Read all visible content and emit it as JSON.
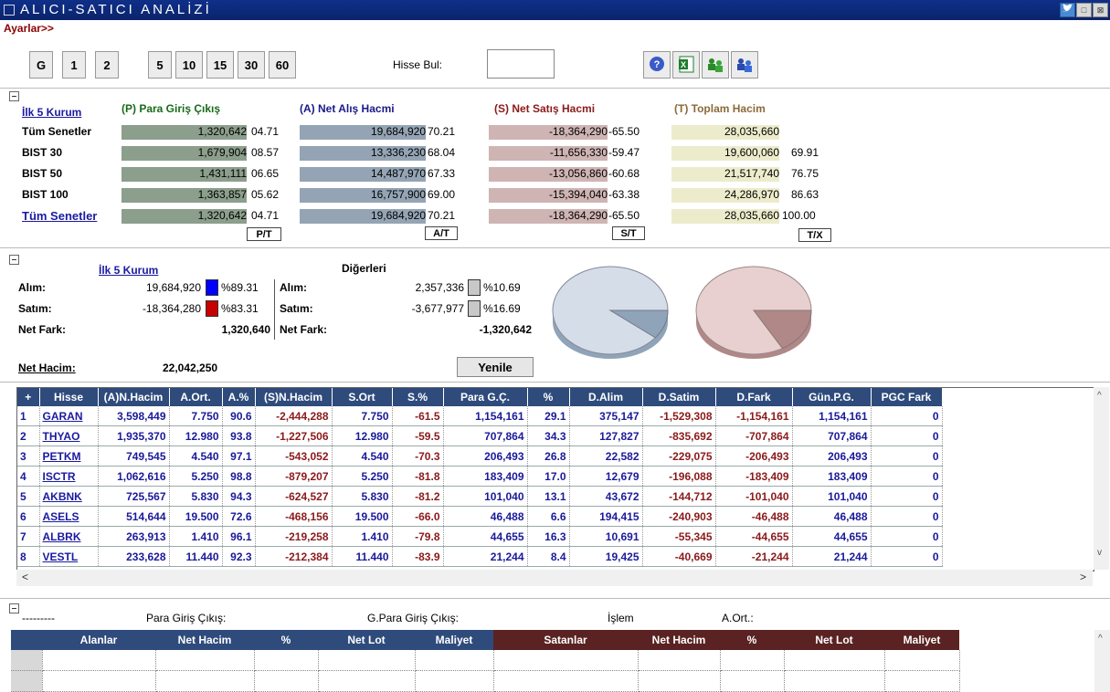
{
  "window": {
    "title": "ALICI-SATICI ANALİZİ",
    "min": "□",
    "close": "⊠"
  },
  "menu": {
    "ayarlar": "Ayarlar>>"
  },
  "toolbar": {
    "periods": [
      "G",
      "1",
      "2"
    ],
    "periods2": [
      "5",
      "10",
      "15",
      "30",
      "60"
    ],
    "search_label": "Hisse Bul:",
    "search_value": ""
  },
  "summary": {
    "col_label": "İlk 5 Kurum",
    "headers": {
      "p": "(P) Para Giriş Çıkış",
      "a": "(A) Net Alış Hacmi",
      "s": "(S) Net Satış Hacmi",
      "t": "(T) Toplam Hacim"
    },
    "rows": [
      {
        "name": "Tüm Senetler",
        "p": "1,320,642",
        "pp": "04.71",
        "a": "19,684,920",
        "ap": "70.21",
        "s": "-18,364,290",
        "sp": "-65.50",
        "t": "28,035,660",
        "tp": ""
      },
      {
        "name": "BIST 30",
        "p": "1,679,904",
        "pp": "08.57",
        "a": "13,336,230",
        "ap": "68.04",
        "s": "-11,656,330",
        "sp": "-59.47",
        "t": "19,600,060",
        "tp": "69.91"
      },
      {
        "name": "BIST 50",
        "p": "1,431,111",
        "pp": "06.65",
        "a": "14,487,970",
        "ap": "67.33",
        "s": "-13,056,860",
        "sp": "-60.68",
        "t": "21,517,740",
        "tp": "76.75"
      },
      {
        "name": "BIST 100",
        "p": "1,363,857",
        "pp": "05.62",
        "a": "16,757,900",
        "ap": "69.00",
        "s": "-15,394,040",
        "sp": "-63.38",
        "t": "24,286,970",
        "tp": "86.63"
      },
      {
        "name": "Tüm Senetler",
        "p": "1,320,642",
        "pp": "04.71",
        "a": "19,684,920",
        "ap": "70.21",
        "s": "-18,364,290",
        "sp": "-65.50",
        "t": "28,035,660",
        "tp": "100.00"
      }
    ],
    "sort_buttons": [
      "P/T",
      "A/T",
      "S/T",
      "T/X"
    ]
  },
  "compare": {
    "ilk5_label": "İlk 5 Kurum",
    "digerleri_label": "Diğerleri",
    "alim_label": "Alım:",
    "satim_label": "Satım:",
    "netfark_label": "Net Fark:",
    "ilk5": {
      "alim": "19,684,920",
      "alim_pct": "%89.31",
      "satim": "-18,364,280",
      "satim_pct": "%83.31",
      "netfark": "1,320,640"
    },
    "diger": {
      "alim": "2,357,336",
      "alim_pct": "%10.69",
      "satim": "-3,677,977",
      "satim_pct": "%16.69",
      "netfark": "-1,320,642"
    },
    "nethacim_label": "Net Hacim:",
    "nethacim": "22,042,250",
    "yenile": "Yenile"
  },
  "pies": [
    {
      "share": 0.1069
    },
    {
      "share": 0.1669
    }
  ],
  "table": {
    "columns": [
      "+",
      "Hisse",
      "(A)N.Hacim",
      "A.Ort.",
      "A.%",
      "(S)N.Hacim",
      "S.Ort",
      "S.%",
      "Para G.Ç.",
      "%",
      "D.Alim",
      "D.Satim",
      "D.Fark",
      "Gün.P.G.",
      "PGC Fark"
    ],
    "rows": [
      [
        "1",
        "GARAN",
        "3,598,449",
        "7.750",
        "90.6",
        "-2,444,288",
        "7.750",
        "-61.5",
        "1,154,161",
        "29.1",
        "375,147",
        "-1,529,308",
        "-1,154,161",
        "1,154,161",
        "0"
      ],
      [
        "2",
        "THYAO",
        "1,935,370",
        "12.980",
        "93.8",
        "-1,227,506",
        "12.980",
        "-59.5",
        "707,864",
        "34.3",
        "127,827",
        "-835,692",
        "-707,864",
        "707,864",
        "0"
      ],
      [
        "3",
        "PETKM",
        "749,545",
        "4.540",
        "97.1",
        "-543,052",
        "4.540",
        "-70.3",
        "206,493",
        "26.8",
        "22,582",
        "-229,075",
        "-206,493",
        "206,493",
        "0"
      ],
      [
        "4",
        "ISCTR",
        "1,062,616",
        "5.250",
        "98.8",
        "-879,207",
        "5.250",
        "-81.8",
        "183,409",
        "17.0",
        "12,679",
        "-196,088",
        "-183,409",
        "183,409",
        "0"
      ],
      [
        "5",
        "AKBNK",
        "725,567",
        "5.830",
        "94.3",
        "-624,527",
        "5.830",
        "-81.2",
        "101,040",
        "13.1",
        "43,672",
        "-144,712",
        "-101,040",
        "101,040",
        "0"
      ],
      [
        "6",
        "ASELS",
        "514,644",
        "19.500",
        "72.6",
        "-468,156",
        "19.500",
        "-66.0",
        "46,488",
        "6.6",
        "194,415",
        "-240,903",
        "-46,488",
        "46,488",
        "0"
      ],
      [
        "7",
        "ALBRK",
        "263,913",
        "1.410",
        "96.1",
        "-219,258",
        "1.410",
        "-79.8",
        "44,655",
        "16.3",
        "10,691",
        "-55,345",
        "-44,655",
        "44,655",
        "0"
      ],
      [
        "8",
        "VESTL",
        "233,628",
        "11.440",
        "92.3",
        "-212,384",
        "11.440",
        "-83.9",
        "21,244",
        "8.4",
        "19,425",
        "-40,669",
        "-21,244",
        "21,244",
        "0"
      ]
    ]
  },
  "bottom": {
    "dashes": "---------",
    "pgc": "Para Giriş Çıkış:",
    "gpgc": "G.Para Giriş Çıkış:",
    "islem": "İşlem",
    "aort": "A.Ort.:",
    "buyers_cols": [
      "Alanlar",
      "Net Hacim",
      "%",
      "Net Lot",
      "Maliyet"
    ],
    "sellers_cols": [
      "Satanlar",
      "Net Hacim",
      "%",
      "Net Lot",
      "Maliyet"
    ]
  },
  "colors": {
    "p_bar": "#8c9e8c",
    "a_bar": "#94a4b4",
    "s_bar": "#cfb4b4",
    "t_bar": "#ececcc",
    "header_blue": "#2e4b7c",
    "header_red": "#5a2222"
  }
}
